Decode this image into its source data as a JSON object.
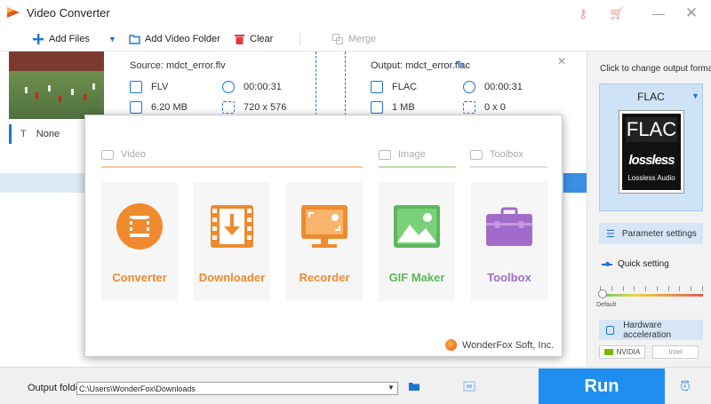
{
  "app": {
    "title": "Video Converter"
  },
  "toolbar": {
    "add_files": "Add Files",
    "add_video_folder": "Add Video Folder",
    "clear": "Clear",
    "merge": "Merge"
  },
  "file": {
    "source_label": "Source: mdct_error.flv",
    "output_label": "Output: mdct_error.flac",
    "source": {
      "format": "FLV",
      "duration": "00:00:31",
      "size": "6.20 MB",
      "resolution": "720 x 576"
    },
    "output": {
      "format": "FLAC",
      "duration": "00:00:31",
      "size": "1 MB",
      "resolution": "0 x 0"
    },
    "subtitle": "None"
  },
  "right_panel": {
    "title": "Click to change output format:",
    "format_name": "FLAC",
    "logo_text": "FLAC",
    "logo_lossless": "lossless",
    "logo_audio": "Lossless Audio",
    "parameter_settings": "Parameter settings",
    "quick_setting": "Quick setting",
    "slider_default": "Default",
    "hardware_acceleration": "Hardware acceleration",
    "gpu_nvidia": "NVIDIA",
    "gpu_intel": "Intel"
  },
  "bottom": {
    "output_folder_label": "Output folder:",
    "output_folder_path": "C:\\Users\\WonderFox\\Downloads",
    "run_label": "Run"
  },
  "launcher": {
    "categories": {
      "video": "Video",
      "image": "Image",
      "toolbox": "Toolbox"
    },
    "tiles": [
      {
        "label": "Converter",
        "color": "#f08a2e"
      },
      {
        "label": "Downloader",
        "color": "#f08a2e"
      },
      {
        "label": "Recorder",
        "color": "#f08a2e"
      },
      {
        "label": "GIF Maker",
        "color": "#5cb85c"
      },
      {
        "label": "Toolbox",
        "color": "#a36bc9"
      }
    ],
    "brand": "WonderFox Soft, Inc."
  }
}
